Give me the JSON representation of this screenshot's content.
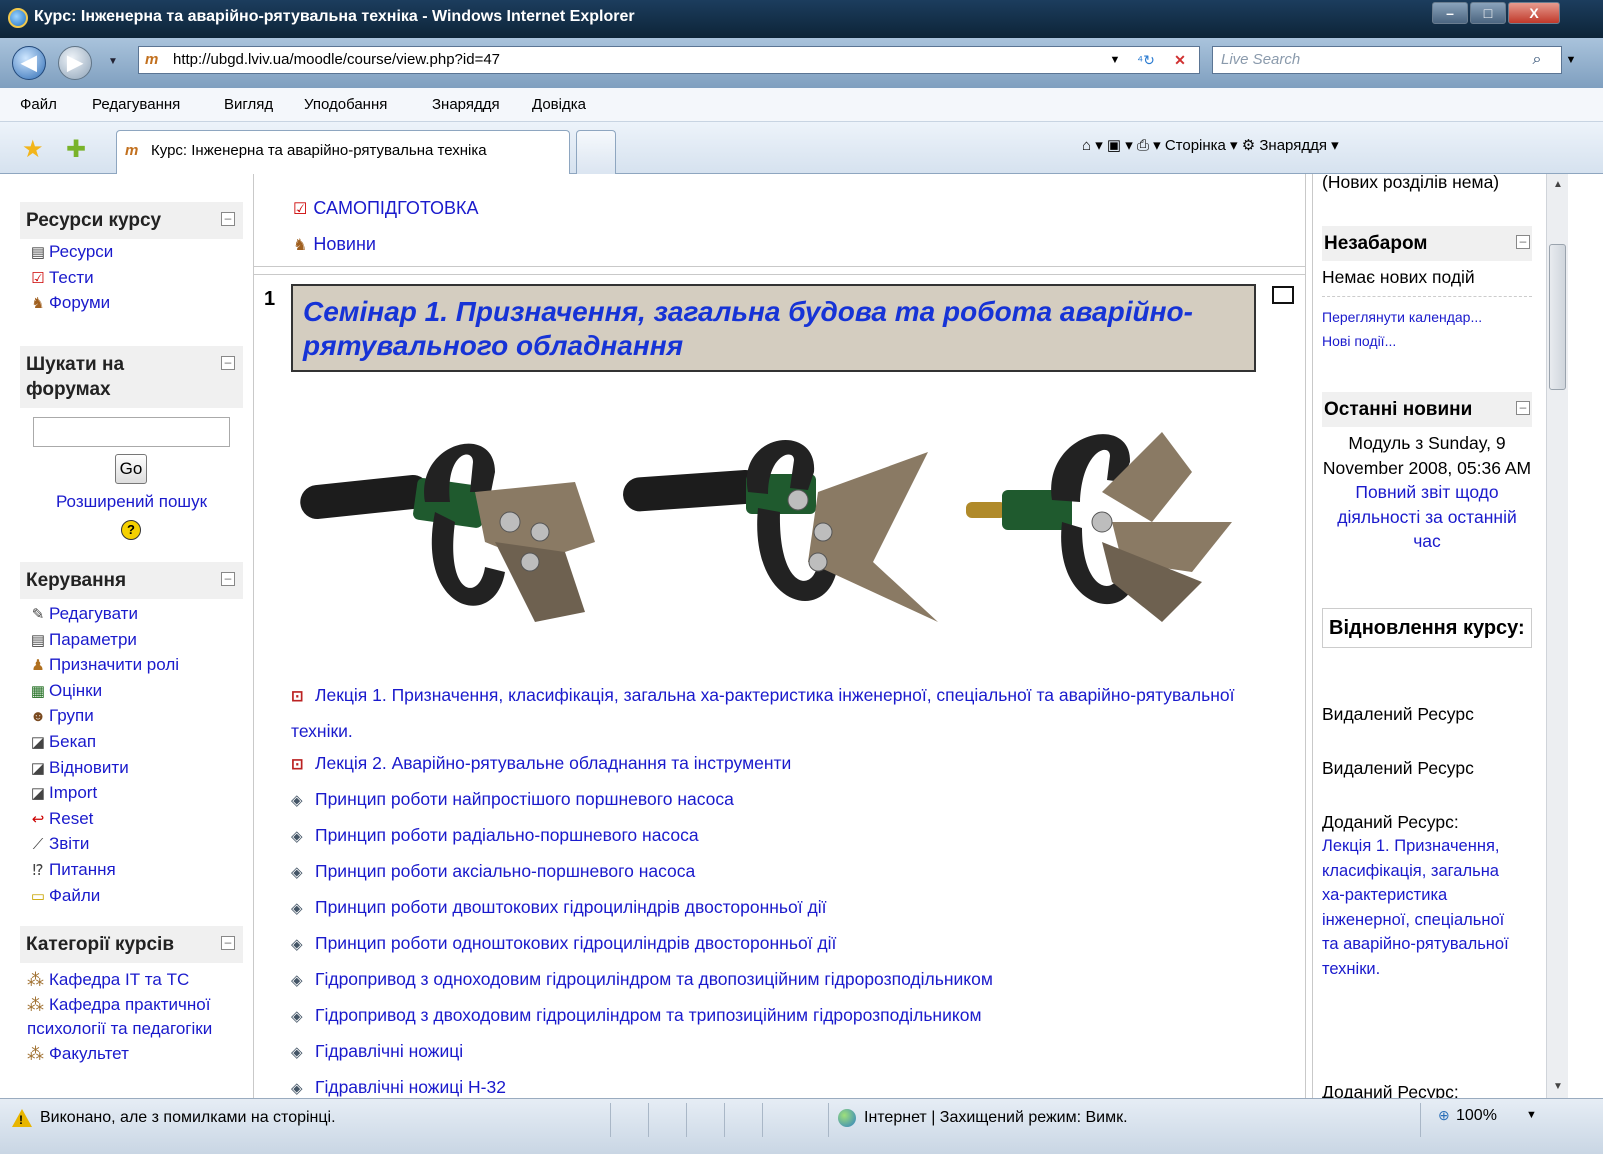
{
  "window": {
    "title": "Курс: Інженерна та аварійно-рятувальна техніка - Windows Internet Explorer",
    "min_symbol": "–",
    "max_symbol": "□",
    "close_symbol": "X"
  },
  "address": {
    "back_symbol": "◀",
    "forward_symbol": "▶",
    "dropdown_symbol": "▼",
    "moodle_glyph": "m",
    "url": "http://ubgd.lviv.ua/moodle/course/view.php?id=47",
    "refresh_symbol": "⁴↻",
    "stop_symbol": "✕",
    "search_placeholder": "Live Search",
    "search_symbol": "⌕"
  },
  "menu": [
    "Файл",
    "Редагування",
    "Вигляд",
    "Уподобання",
    "Знаряддя",
    "Довідка"
  ],
  "tabs": {
    "active_label": "Курс: Інженерна та аварійно-рятувальна техніка",
    "commands": "⌂ ▾  ▣ ▾  ⎙ ▾  Сторінка ▾  ⚙ Знаряддя ▾"
  },
  "left": {
    "resources": {
      "title": "Ресурси курсу",
      "items": [
        "Ресурси",
        "Тести",
        "Форуми"
      ]
    },
    "search": {
      "title": "Шукати на форумах",
      "go_label": "Go",
      "advanced_label": "Розширений пошук",
      "help_symbol": "?"
    },
    "admin": {
      "title": "Керування",
      "items": [
        "Редагувати",
        "Параметри",
        "Призначити ролі",
        "Оцінки",
        "Групи",
        "Бекап",
        "Відновити",
        "Import",
        "Reset",
        "Звіти",
        "Питання",
        "Файли"
      ]
    },
    "categories": {
      "title": "Категорії курсів",
      "items": [
        "Кафедра ІТ та ТС",
        "Кафедра практичної психології та педагогіки",
        "Факультет"
      ]
    },
    "collapse_symbol": "–"
  },
  "main": {
    "top_links": [
      "САМОПІДГОТОВКА",
      "Новини"
    ],
    "section_number": "1",
    "section_title": "Семінар 1.  Призначення, загальна будова та робота аварійно-рятувального обладнання",
    "resources": [
      "Лекція 1. Призначення, класифікація, загальна ха-рактеристика інженерної, спеціальної та аварійно-рятувальної техніки.",
      "Лекція 2. Аварійно-рятувальне обладнання та інструменти",
      "Принцип роботи найпростішого поршневого насоса",
      "Принцип роботи радіально-поршневого насоса",
      "Принцип роботи аксіально-поршневого насоса",
      "Принцип роботи двоштокових гідроциліндрів двосторонньої дії",
      "Принцип роботи одноштокових гідроциліндрів двосторонньої дії",
      "Гідропривод з одноходовим гідроциліндром та двопозиційним гідророзподільником",
      "Гідропривод з двоходовим гідроциліндром та трипозиційним гідророзподільником",
      "Гідравлічні ножиці",
      "Гідравлічні ножиці Н-32"
    ]
  },
  "right": {
    "no_new_sections": "(Нових розділів нема)",
    "upcoming": {
      "title": "Незабаром",
      "no_events": "Немає нових подій",
      "calendar_link": "Переглянути календар...",
      "new_event_link": "Нові події..."
    },
    "news": {
      "title": "Останні новини",
      "module_text": "Модуль з Sunday, 9 November 2008, 05:36 AM",
      "full_report_link": "Повний звіт щодо діяльності за останній час"
    },
    "restore": {
      "title": "Відновлення курсу:",
      "deleted1": "Видалений Ресурс",
      "deleted2": "Видалений Ресурс",
      "added": "Доданий Ресурс:",
      "added_link": "Лекція 1. Призначення, класифікація, загальна ха-рактеристика інженерної, спеціальної та аварійно-рятувальної техніки.",
      "added2": "Доданий Ресурс:"
    }
  },
  "status": {
    "message": "Виконано, але з помилками на сторінці.",
    "zone": "Інтернет | Захищений режим: Вимк.",
    "zoom": "100%",
    "warn_symbol": "!"
  },
  "colors": {
    "link": "#1a1acc",
    "section_title_bg": "#d4cdc0",
    "section_title_text": "#1633d6",
    "block_header_bg": "#f0f0f0"
  }
}
